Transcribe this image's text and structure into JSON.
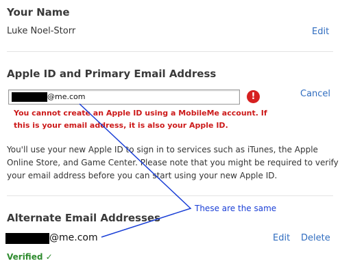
{
  "name_section": {
    "title": "Your Name",
    "value": "Luke Noel-Storr",
    "edit_label": "Edit"
  },
  "apple_id_section": {
    "title": "Apple ID and Primary Email Address",
    "email_value": "@me.com",
    "cancel_label": "Cancel",
    "error_icon": "!",
    "error_line1": "You cannot create an Apple ID using a MobileMe account. If",
    "error_line2": "this is your email address, it is also your Apple ID.",
    "info_line1": "You'll use your new Apple ID to sign in to services such as iTunes, the Apple",
    "info_line2": "Online Store, and Game Center. Please note that you might be required to verify",
    "info_line3": "your email address before you can start using your new Apple ID."
  },
  "alternate_section": {
    "title": "Alternate Email Addresses",
    "email_value": "@me.com",
    "edit_label": "Edit",
    "delete_label": "Delete",
    "verified_label": "Verified ✓"
  },
  "annotation": {
    "text": "These are the same",
    "color": "#1a3fd6"
  },
  "colors": {
    "link": "#2f6cbf",
    "error": "#cc1a1a",
    "verified": "#2e8b2e"
  }
}
